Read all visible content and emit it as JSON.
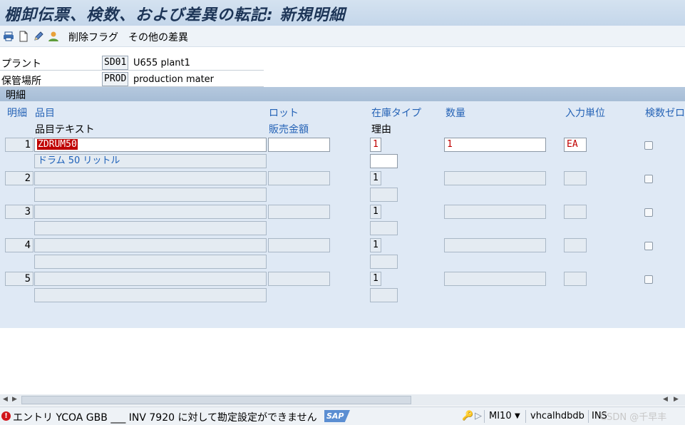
{
  "window": {
    "title": "棚卸伝票、検数、および差異の転記: 新規明細"
  },
  "toolbar": {
    "icons": [
      "print-icon",
      "new-document-icon",
      "edit-pencil-icon",
      "person-icon"
    ],
    "delete_flag": "削除フラグ",
    "other_diff": "その他の差異"
  },
  "header": {
    "plant_label": "プラント",
    "plant_code": "SD01",
    "plant_desc": "U655 plant1",
    "sloc_label": "保管場所",
    "sloc_code": "PROD",
    "sloc_desc": "production mater"
  },
  "section": {
    "title": "明細"
  },
  "columns": {
    "item": "明細",
    "material": "品目",
    "material_text": "品目テキスト",
    "lot": "ロット",
    "sales_amount": "販売金額",
    "stock_type": "在庫タイプ",
    "reason": "理由",
    "quantity": "数量",
    "entry_unit": "入力単位",
    "zero_count": "検数ゼロ"
  },
  "rows": [
    {
      "no": "1",
      "material": "ZDRUM50",
      "text": "ドラム 50 リットル",
      "stock_type": "1",
      "quantity": "1",
      "unit": "EA"
    },
    {
      "no": "2",
      "material": "",
      "text": "",
      "stock_type": "1",
      "quantity": "",
      "unit": ""
    },
    {
      "no": "3",
      "material": "",
      "text": "",
      "stock_type": "1",
      "quantity": "",
      "unit": ""
    },
    {
      "no": "4",
      "material": "",
      "text": "",
      "stock_type": "1",
      "quantity": "",
      "unit": ""
    },
    {
      "no": "5",
      "material": "",
      "text": "",
      "stock_type": "1",
      "quantity": "",
      "unit": ""
    }
  ],
  "status_bar": {
    "message": "エントリ YCOA GBB ___ INV 7920 に対して勘定設定ができません",
    "logo": "SAP",
    "transaction": "MI10",
    "server": "vhcalhdbdb",
    "mode": "INS",
    "watermark": "CSDN @千早丰"
  },
  "colors": {
    "title_bg": "#c4d6ea",
    "section_bg": "#a7bdd6",
    "grid_bg": "#dfe9f5",
    "error_red": "#c00000",
    "header_blue": "#2563b6"
  }
}
